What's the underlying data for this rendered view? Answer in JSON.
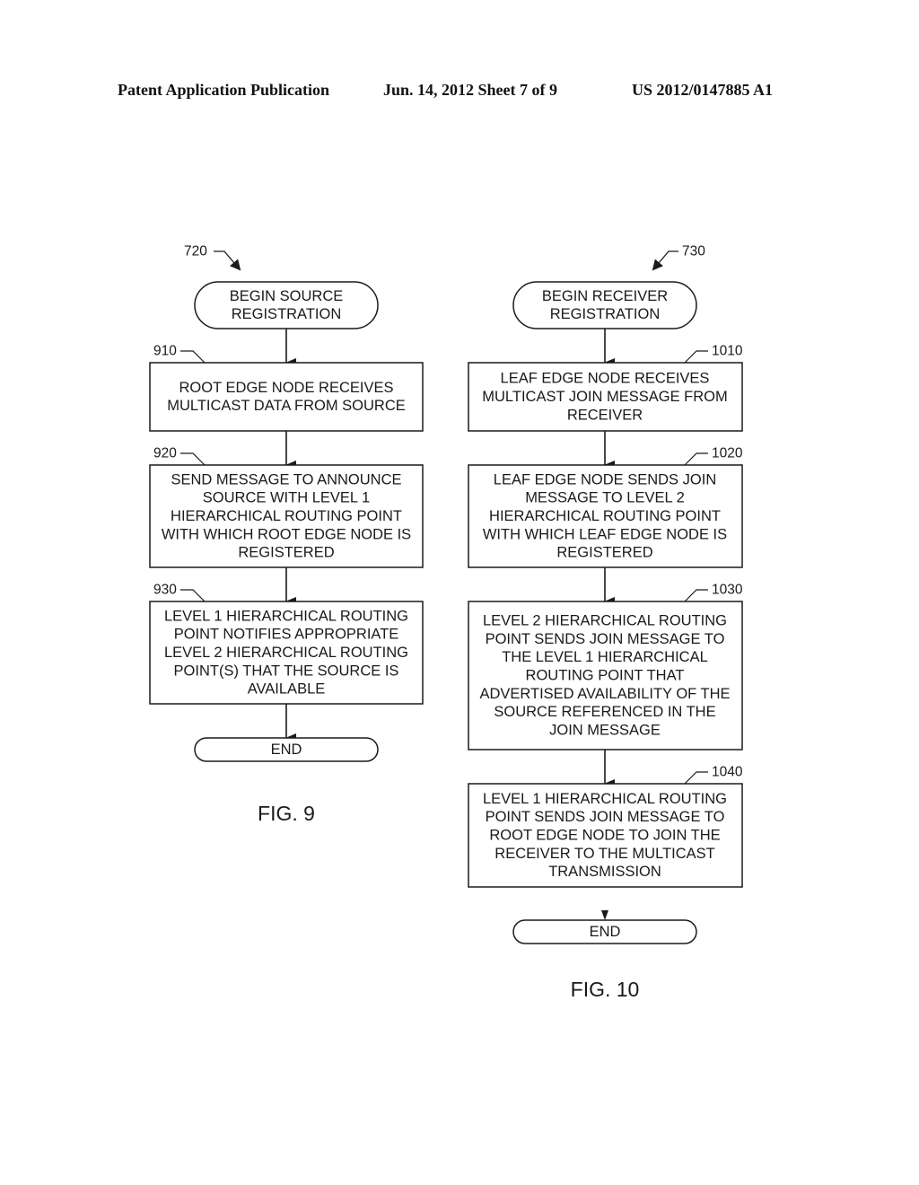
{
  "header": {
    "left": "Patent Application Publication",
    "center": "Jun. 14, 2012  Sheet 7 of 9",
    "right": "US 2012/0147885 A1"
  },
  "figures": [
    {
      "id": "fig9",
      "caption": "FIG. 9",
      "ref": "720",
      "start": [
        "BEGIN SOURCE",
        "REGISTRATION"
      ],
      "end": [
        "END"
      ],
      "steps": [
        {
          "ref": "910",
          "lines": [
            "ROOT EDGE NODE RECEIVES",
            "MULTICAST DATA FROM SOURCE"
          ]
        },
        {
          "ref": "920",
          "lines": [
            "SEND MESSAGE TO ANNOUNCE",
            "SOURCE WITH LEVEL 1",
            "HIERARCHICAL ROUTING POINT",
            "WITH WHICH ROOT EDGE NODE IS",
            "REGISTERED"
          ]
        },
        {
          "ref": "930",
          "lines": [
            "LEVEL 1 HIERARCHICAL ROUTING",
            "POINT NOTIFIES APPROPRIATE",
            "LEVEL 2 HIERARCHICAL ROUTING",
            "POINT(S) THAT THE SOURCE IS",
            "AVAILABLE"
          ]
        }
      ]
    },
    {
      "id": "fig10",
      "caption": "FIG. 10",
      "ref": "730",
      "start": [
        "BEGIN RECEIVER",
        "REGISTRATION"
      ],
      "end": [
        "END"
      ],
      "steps": [
        {
          "ref": "1010",
          "lines": [
            "LEAF EDGE NODE RECEIVES",
            "MULTICAST JOIN MESSAGE FROM",
            "RECEIVER"
          ]
        },
        {
          "ref": "1020",
          "lines": [
            "LEAF EDGE NODE SENDS JOIN",
            "MESSAGE TO LEVEL 2",
            "HIERARCHICAL ROUTING POINT",
            "WITH WHICH LEAF EDGE NODE IS",
            "REGISTERED"
          ]
        },
        {
          "ref": "1030",
          "lines": [
            "LEVEL 2 HIERARCHICAL ROUTING",
            "POINT SENDS JOIN MESSAGE TO",
            "THE LEVEL 1 HIERARCHICAL",
            "ROUTING POINT THAT",
            "ADVERTISED AVAILABILITY OF THE",
            "SOURCE REFERENCED IN THE",
            "JOIN MESSAGE"
          ]
        },
        {
          "ref": "1040",
          "lines": [
            "LEVEL 1 HIERARCHICAL ROUTING",
            "POINT SENDS JOIN MESSAGE TO",
            "ROOT EDGE NODE TO JOIN THE",
            "RECEIVER TO THE MULTICAST",
            "TRANSMISSION"
          ]
        }
      ]
    }
  ]
}
